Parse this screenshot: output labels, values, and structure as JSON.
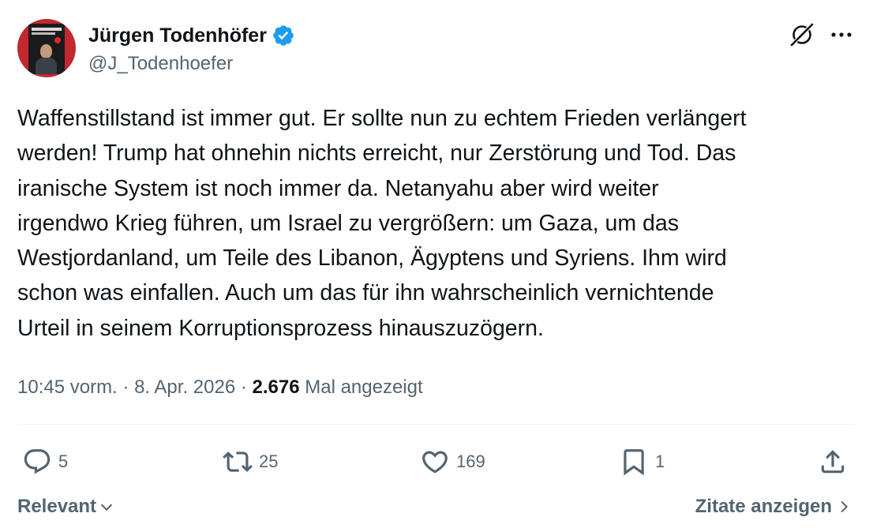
{
  "author": {
    "name": "Jürgen Todenhöfer",
    "handle": "@J_Todenhoefer",
    "verified": true,
    "verified_color": "#1d9bf0"
  },
  "header_icons": [
    "grok-icon",
    "more-icon"
  ],
  "tweet": {
    "text": "Waffenstillstand ist immer gut. Er sollte nun zu echtem Frieden verlängert\nwerden! Trump hat ohnehin nichts erreicht, nur Zerstörung und Tod. Das\niranische System ist noch immer da. Netanyahu aber wird weiter\nirgendwo Krieg führen, um Israel zu vergrößern: um Gaza, um das\nWestjordanland, um Teile des Libanon, Ägyptens und Syriens. Ihm wird\nschon was einfallen. Auch um das für ihn wahrscheinlich vernichtende\nUrteil in seinem Korruptionsprozess hinauszuzögern."
  },
  "meta": {
    "time": "10:45 vorm.",
    "separator": " · ",
    "date": "8. Apr. 2026",
    "views": "2.676",
    "views_label": " Mal angezeigt"
  },
  "actions": {
    "replies": "5",
    "reposts": "25",
    "likes": "169",
    "bookmarks": "1"
  },
  "footer": {
    "sort_label": "Relevant",
    "quotes_label": "Zitate anzeigen"
  },
  "colors": {
    "text": "#0f1419",
    "secondary": "#536471",
    "divider": "#eff3f4"
  }
}
